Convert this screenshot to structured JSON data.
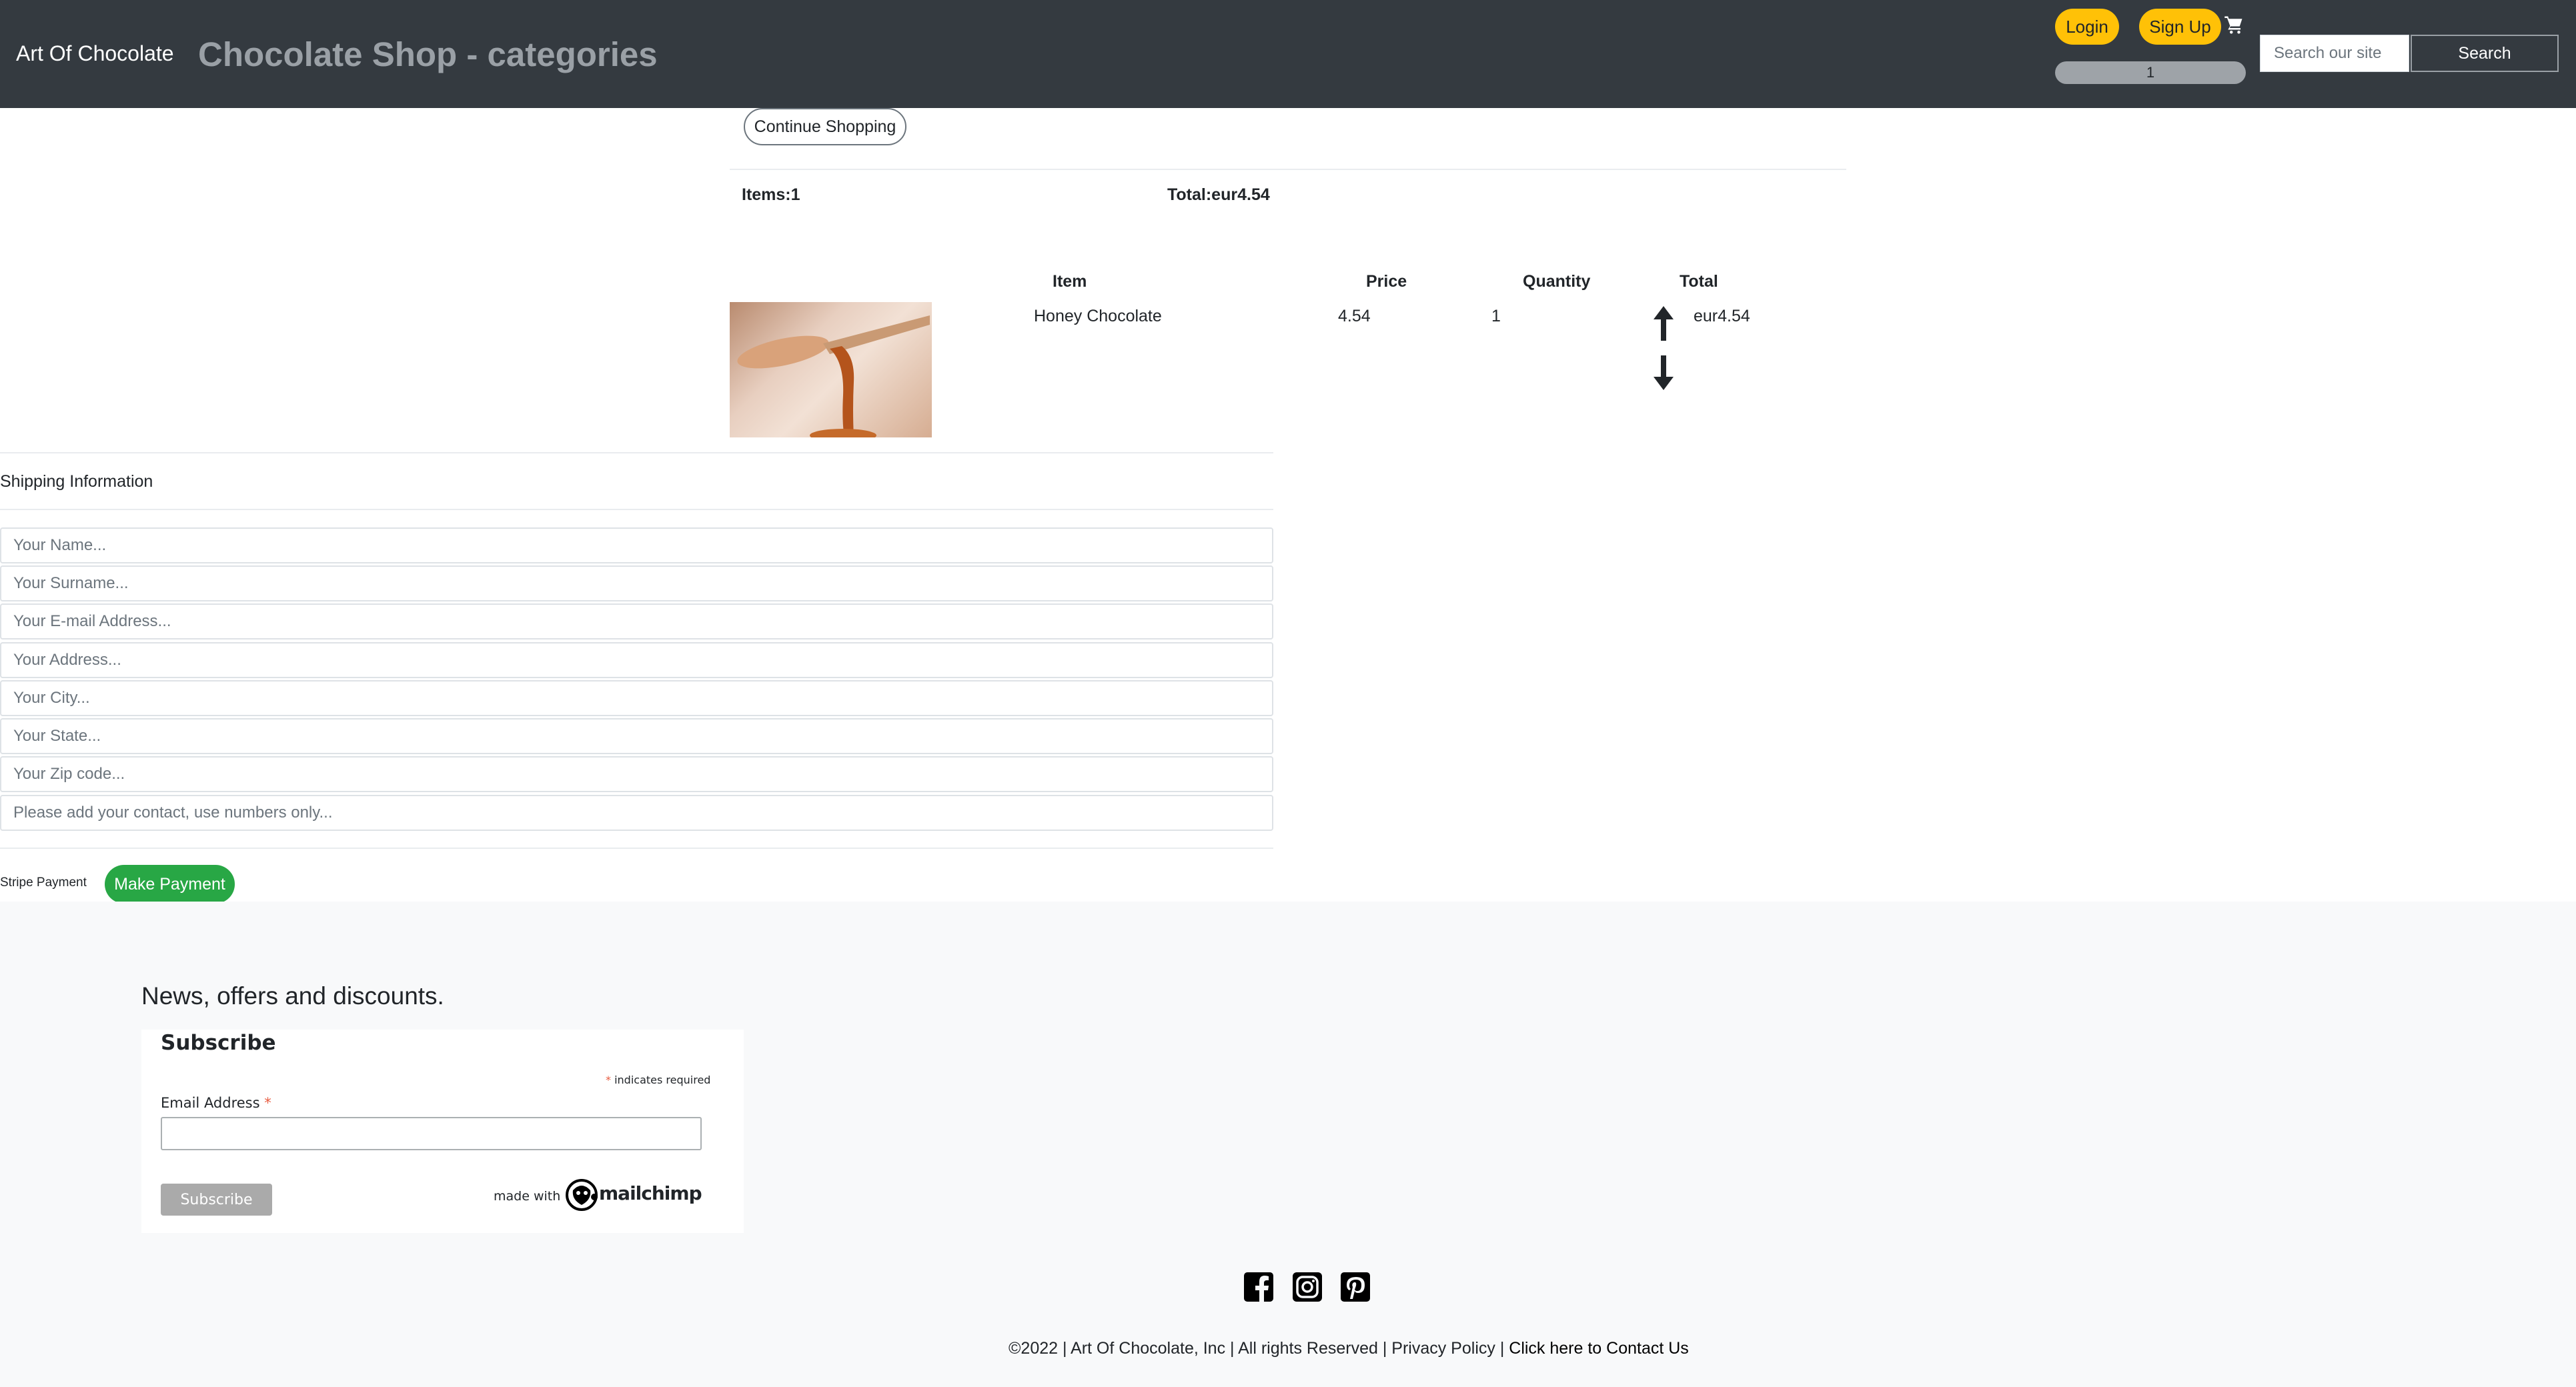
{
  "navbar": {
    "brand": "Art Of Chocolate",
    "title": "Chocolate Shop - categories",
    "login": "Login",
    "signup": "Sign Up",
    "cart_icon": "shopping-cart-icon",
    "cart_count": "1",
    "search_placeholder": "Search our site",
    "search_button": "Search"
  },
  "cart": {
    "continue": "Continue Shopping",
    "items_summary": "Items:1",
    "total_summary": "Total:eur4.54",
    "headers": {
      "item": "Item",
      "price": "Price",
      "quantity": "Quantity",
      "total": "Total"
    },
    "rows": [
      {
        "name": "Honey Chocolate",
        "price": "4.54",
        "quantity": "1",
        "total": "eur4.54",
        "image": "honey-dripping-from-spoon",
        "increase_icon": "arrow-up-icon",
        "decrease_icon": "arrow-down-icon"
      }
    ]
  },
  "shipping": {
    "title": "Shipping Information",
    "fields": {
      "name": "Your Name...",
      "surname": "Your Surname...",
      "email": "Your E-mail Address...",
      "address": "Your Address...",
      "city": "Your City...",
      "state": "Your State...",
      "zip": "Your Zip code...",
      "contact": "Please add your contact, use numbers only..."
    }
  },
  "payment": {
    "label": "Stripe Payment",
    "button": "Make Payment",
    "button_color": "#28a745"
  },
  "footer": {
    "news": "News, offers and discounts.",
    "mailchimp": {
      "title": "Subscribe",
      "required_mark": "*",
      "required_note": "indicates required",
      "email_label": "Email Address",
      "subscribe_button": "Subscribe",
      "made_with": "made with",
      "logo_text": "mailchimp"
    },
    "social_icons": [
      "facebook-icon",
      "instagram-icon",
      "pinterest-icon"
    ],
    "copyright_prefix": "©2022 | Art Of Chocolate, Inc | All rights Reserved | ",
    "privacy": "Privacy Policy",
    "separator": " | ",
    "contact": "Click here to Contact Us"
  },
  "colors": {
    "navbar_bg": "#343a40",
    "accent_yellow": "#ffc107",
    "footer_bg": "#f8f9fa"
  }
}
